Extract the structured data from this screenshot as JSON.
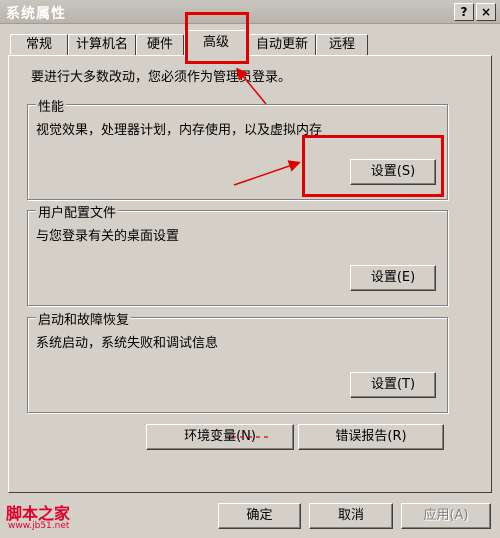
{
  "window": {
    "title": "系统属性",
    "help_button": "?",
    "close_button": "×"
  },
  "tabs": [
    {
      "label": "常规"
    },
    {
      "label": "计算机名"
    },
    {
      "label": "硬件"
    },
    {
      "label": "高级",
      "active": true
    },
    {
      "label": "自动更新"
    },
    {
      "label": "远程"
    }
  ],
  "notice": "要进行大多数改动，您必须作为管理员登录。",
  "groups": {
    "performance": {
      "label": "性能",
      "description": "视觉效果，处理器计划，内存使用，以及虚拟内存",
      "button": "设置(S)"
    },
    "user_profiles": {
      "label": "用户配置文件",
      "description": "与您登录有关的桌面设置",
      "button": "设置(E)"
    },
    "startup_recovery": {
      "label": "启动和故障恢复",
      "description": "系统启动，系统失败和调试信息",
      "button": "设置(T)"
    }
  },
  "buttons": {
    "env_vars": "环境变量(N)",
    "error_report": "错误报告(R)",
    "ok": "确定",
    "cancel": "取消",
    "apply": "应用(A)"
  },
  "watermark": {
    "site_name": "脚本之家",
    "site_url": "www.jb51.net"
  },
  "annotation_color": "#e00000"
}
